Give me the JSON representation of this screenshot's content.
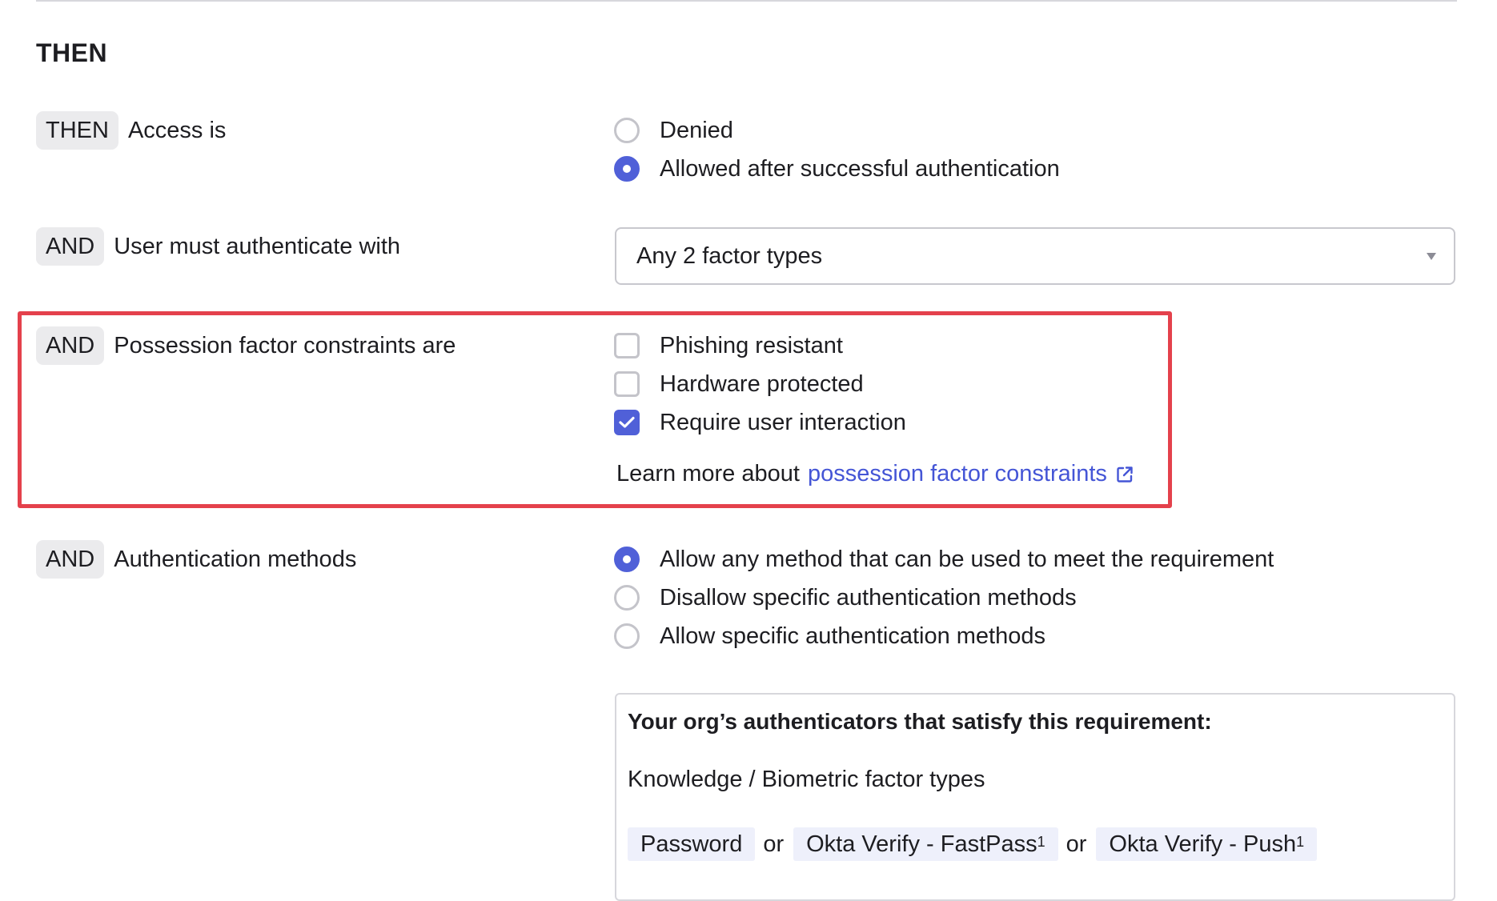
{
  "section_title": "THEN",
  "access": {
    "keyword": "THEN",
    "label": "Access is",
    "options": [
      {
        "label": "Denied",
        "selected": false
      },
      {
        "label": "Allowed after successful authentication",
        "selected": true
      }
    ]
  },
  "authenticate": {
    "keyword": "AND",
    "label": "User must authenticate with",
    "selected_value": "Any 2 factor types"
  },
  "possession": {
    "keyword": "AND",
    "label": "Possession factor constraints are",
    "options": [
      {
        "label": "Phishing resistant",
        "checked": false
      },
      {
        "label": "Hardware protected",
        "checked": false
      },
      {
        "label": "Require user interaction",
        "checked": true
      }
    ],
    "learn_more_prefix": "Learn more about",
    "learn_more_link": "possession factor constraints"
  },
  "methods": {
    "keyword": "AND",
    "label": "Authentication methods",
    "options": [
      {
        "label": "Allow any method that can be used to meet the requirement",
        "selected": true
      },
      {
        "label": "Disallow specific authentication methods",
        "selected": false
      },
      {
        "label": "Allow specific authentication methods",
        "selected": false
      }
    ]
  },
  "authenticators": {
    "title": "Your org’s authenticators that satisfy this requirement:",
    "subtitle": "Knowledge / Biometric factor types",
    "chips": [
      {
        "label": "Password",
        "sup": ""
      },
      {
        "label": "Okta Verify - FastPass",
        "sup": "1"
      },
      {
        "label": "Okta Verify - Push",
        "sup": "1"
      }
    ],
    "separator": "or"
  },
  "colors": {
    "accent": "#5060d8",
    "link": "#4455d6",
    "highlight_border": "#e4414c",
    "pill_bg": "#ebebed",
    "chip_bg": "#eef0fb"
  },
  "icons": [
    "caret-down-icon",
    "external-link-icon",
    "checkmark-icon"
  ]
}
